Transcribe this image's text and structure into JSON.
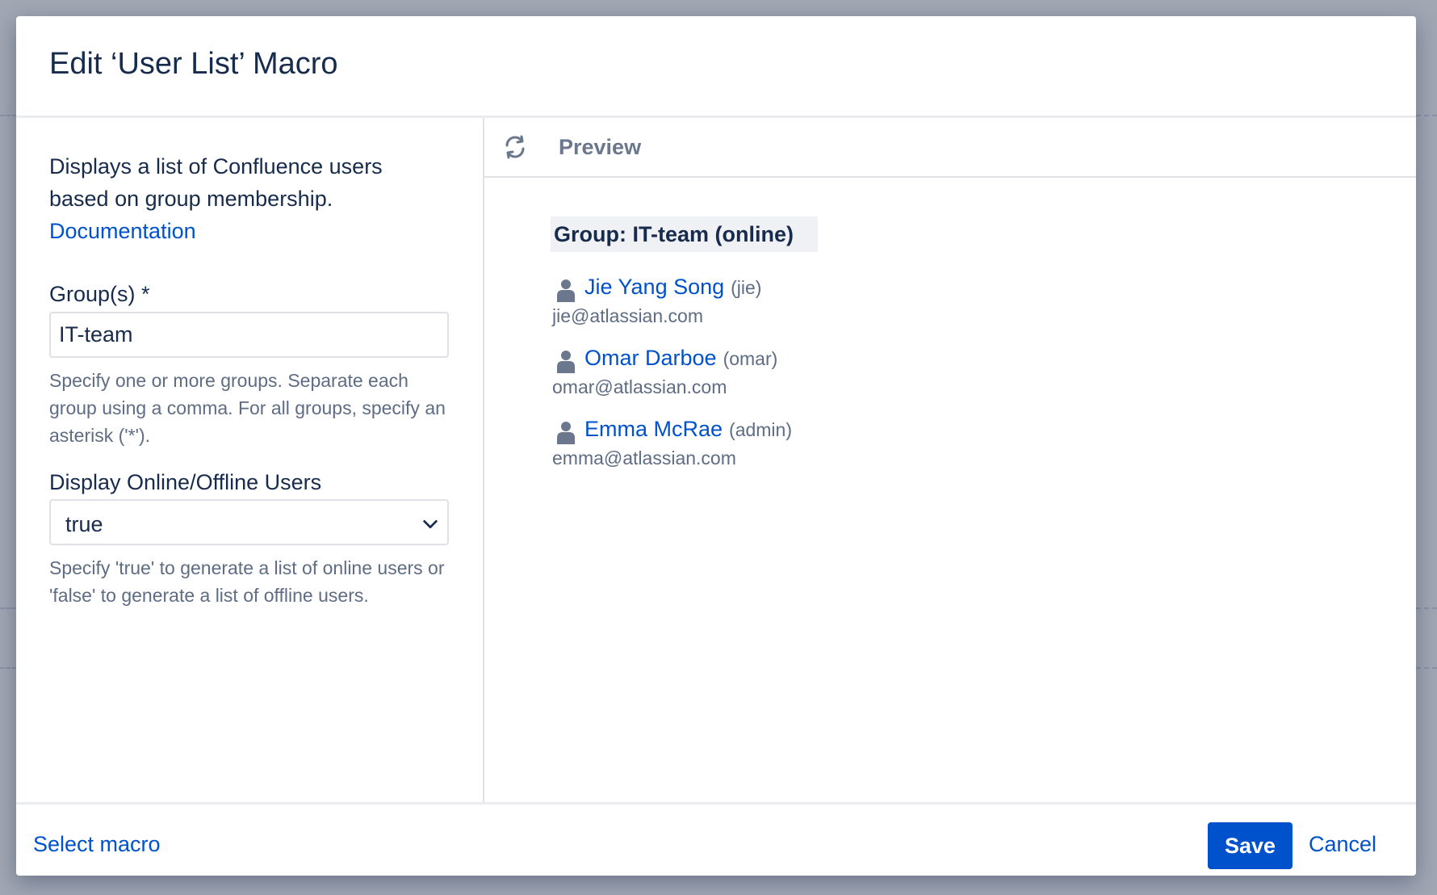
{
  "dialog": {
    "title": "Edit ‘User List’ Macro"
  },
  "left": {
    "description": "Displays a list of Confluence users based on group membership.",
    "documentation_link": "Documentation",
    "groups": {
      "label": "Group(s) *",
      "value": "IT-team",
      "help": "Specify one or more groups. Separate each group using a comma. For all groups, specify an asterisk ('*')."
    },
    "online": {
      "label": "Display Online/Offline Users",
      "selected": "true",
      "help": "Specify 'true' to generate a list of online users or 'false' to generate a list of offline users."
    }
  },
  "preview": {
    "title": "Preview",
    "group_heading": "Group: IT-team (online)",
    "users": [
      {
        "name": "Jie Yang Song",
        "handle": "(jie)",
        "email": "jie@atlassian.com"
      },
      {
        "name": "Omar Darboe",
        "handle": "(omar)",
        "email": "omar@atlassian.com"
      },
      {
        "name": "Emma McRae",
        "handle": "(admin)",
        "email": "emma@atlassian.com"
      }
    ]
  },
  "footer": {
    "select_macro": "Select macro",
    "save": "Save",
    "cancel": "Cancel"
  },
  "icons": {
    "refresh": "refresh-icon",
    "user": "user-icon",
    "chevron": "chevron-down-icon"
  },
  "colors": {
    "primary": "#0052cc",
    "text": "#172b4d",
    "subtle_text": "#5e6c84"
  }
}
